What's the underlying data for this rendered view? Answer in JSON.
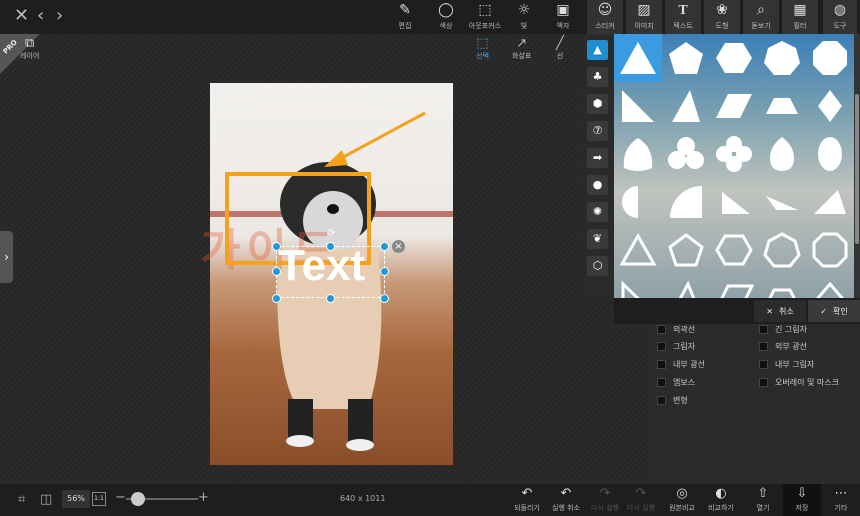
{
  "toolbar": {
    "edit": "편집",
    "color": "색상",
    "outfocus": "아웃포커스",
    "light": "빛",
    "frame": "액자",
    "sticker": "스티커",
    "image": "이미지",
    "text": "텍스트",
    "shape": "도형",
    "magnifier": "돋보기",
    "filter": "필터",
    "tools": "도구"
  },
  "left": {
    "layer": "레이어",
    "pro": "PRO"
  },
  "subtools": {
    "select": "선택",
    "arrow": "화살표",
    "line": "선"
  },
  "canvas": {
    "overlay_text": "Text",
    "watermark": "가이드"
  },
  "shapes": {
    "cancel": "취소",
    "confirm": "확인"
  },
  "effects": {
    "left": [
      "외곽선",
      "그림자",
      "내부 광선",
      "엠보스",
      "변형"
    ],
    "right": [
      "긴 그림자",
      "외부 광선",
      "내부 그림자",
      "오버레이 및 마스크"
    ]
  },
  "bottom": {
    "zoom": "56%",
    "ratio": "1:1",
    "dimensions": "640 x 1011",
    "undo_all": "되돌리기",
    "undo": "실행 취소",
    "redo": "다시 실행",
    "redo_all": "다시 실행",
    "compare_orig": "원본비교",
    "compare": "비교하기",
    "open": "열기",
    "save": "저장",
    "more": "기타"
  },
  "colors": {
    "accent": "#1e9bd7",
    "highlight_box": "#f4a21c",
    "selected_shape": "#3a9be0"
  }
}
